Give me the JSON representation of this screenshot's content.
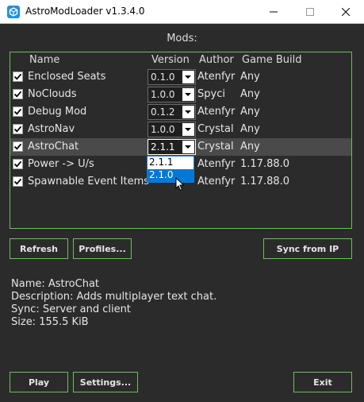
{
  "window": {
    "title": "AstroModLoader v1.3.4.0",
    "icon": "app-cube-icon",
    "controls": [
      "minimize-icon",
      "maximize-icon",
      "close-icon"
    ]
  },
  "mods_heading": "Mods:",
  "columns": {
    "name": "Name",
    "version": "Version",
    "author": "Author",
    "game_build": "Game Build"
  },
  "mods": [
    {
      "enabled": true,
      "name": "Enclosed Seats",
      "version": "0.1.0",
      "author": "Atenfyr",
      "game_build": "Any"
    },
    {
      "enabled": true,
      "name": "NoClouds",
      "version": "1.0.0",
      "author": "Spyci",
      "game_build": "Any"
    },
    {
      "enabled": true,
      "name": "Debug Mod",
      "version": "0.1.2",
      "author": "Atenfyr",
      "game_build": "Any"
    },
    {
      "enabled": true,
      "name": "AstroNav",
      "version": "1.0.0",
      "author": "Crystal",
      "game_build": "Any"
    },
    {
      "enabled": true,
      "name": "AstroChat",
      "version": "2.1.1",
      "author": "Crystal",
      "game_build": "Any",
      "selected": true
    },
    {
      "enabled": true,
      "name": "Power -> U/s",
      "version": "",
      "author": "Atenfyr",
      "game_build": "1.17.88.0"
    },
    {
      "enabled": true,
      "name": "Spawnable Event Items",
      "version": "",
      "author": "Atenfyr",
      "game_build": "1.17.88.0"
    }
  ],
  "version_dropdown": {
    "options": [
      "2.1.1",
      "2.1.0"
    ],
    "highlighted": "2.1.0"
  },
  "buttons": {
    "refresh": "Refresh",
    "profiles": "Profiles...",
    "sync": "Sync from IP",
    "play": "Play",
    "settings": "Settings...",
    "exit": "Exit"
  },
  "info": {
    "name": "Name: AstroChat",
    "description": "Description: Adds multiplayer text chat.",
    "sync": "Sync: Server and client",
    "size": "Size: 155.5 KiB"
  },
  "colors": {
    "background": "#2b2b2b",
    "accent_border": "#6fbf5f",
    "highlight": "#0078d7",
    "selected_row": "#4a4a4a"
  }
}
